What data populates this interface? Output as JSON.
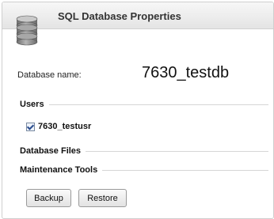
{
  "dialog": {
    "title": "SQL Database Properties"
  },
  "database": {
    "name_label": "Database name:",
    "name_value": "7630_testdb"
  },
  "sections": {
    "users": "Users",
    "files": "Database Files",
    "maintenance": "Maintenance Tools"
  },
  "users": [
    {
      "name": "7630_testusr",
      "checked": true
    }
  ],
  "buttons": {
    "backup": "Backup",
    "restore": "Restore"
  },
  "colors": {
    "icon_gray": "#8a8a8a",
    "header_bg": "#ececec"
  },
  "icons": {
    "header": "database-icon"
  }
}
